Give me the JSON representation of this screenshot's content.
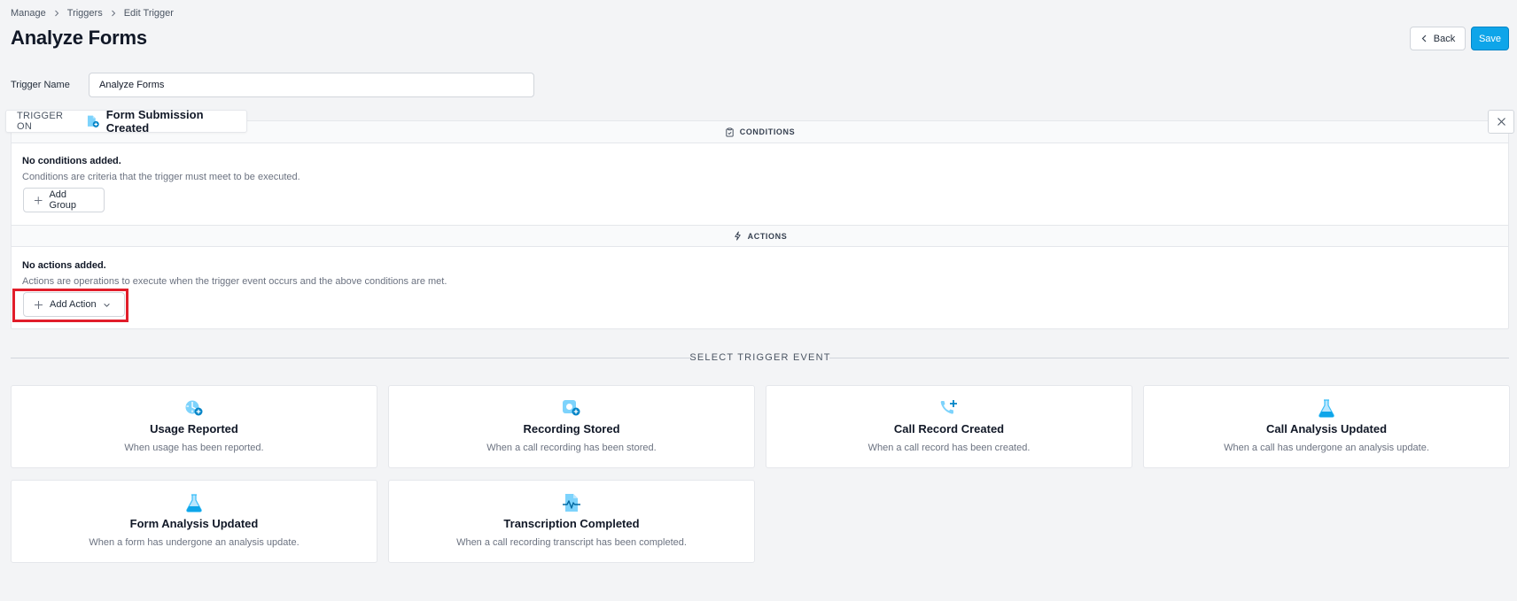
{
  "breadcrumb": [
    "Manage",
    "Triggers",
    "Edit Trigger"
  ],
  "page_title": "Analyze Forms",
  "header": {
    "back_label": "Back",
    "save_label": "Save"
  },
  "trigger_name": {
    "label": "Trigger Name",
    "value": "Analyze Forms"
  },
  "trigger_on": {
    "label": "TRIGGER ON",
    "value": "Form Submission Created",
    "icon": "form-plus-icon"
  },
  "conditions": {
    "header": "CONDITIONS",
    "empty_title": "No conditions added.",
    "empty_desc": "Conditions are criteria that the trigger must meet to be executed.",
    "add_label": "Add Group"
  },
  "actions": {
    "header": "ACTIONS",
    "empty_title": "No actions added.",
    "empty_desc": "Actions are operations to execute when the trigger event occurs and the above conditions are met.",
    "add_label": "Add Action"
  },
  "select_trigger": {
    "heading": "SELECT TRIGGER EVENT",
    "events": [
      {
        "title": "Usage Reported",
        "desc": "When usage has been reported.",
        "icon": "usage-icon"
      },
      {
        "title": "Recording Stored",
        "desc": "When a call recording has been stored.",
        "icon": "recording-icon"
      },
      {
        "title": "Call Record Created",
        "desc": "When a call record has been created.",
        "icon": "phone-plus-icon"
      },
      {
        "title": "Call Analysis Updated",
        "desc": "When a call has undergone an analysis update.",
        "icon": "flask-icon"
      },
      {
        "title": "Form Analysis Updated",
        "desc": "When a form has undergone an analysis update.",
        "icon": "flask-icon"
      },
      {
        "title": "Transcription Completed",
        "desc": "When a call recording transcript has been completed.",
        "icon": "transcript-icon"
      }
    ]
  },
  "colors": {
    "accent": "#0ea5e9",
    "icon_blue": "#38bdf8",
    "highlight": "#e11d2a"
  }
}
